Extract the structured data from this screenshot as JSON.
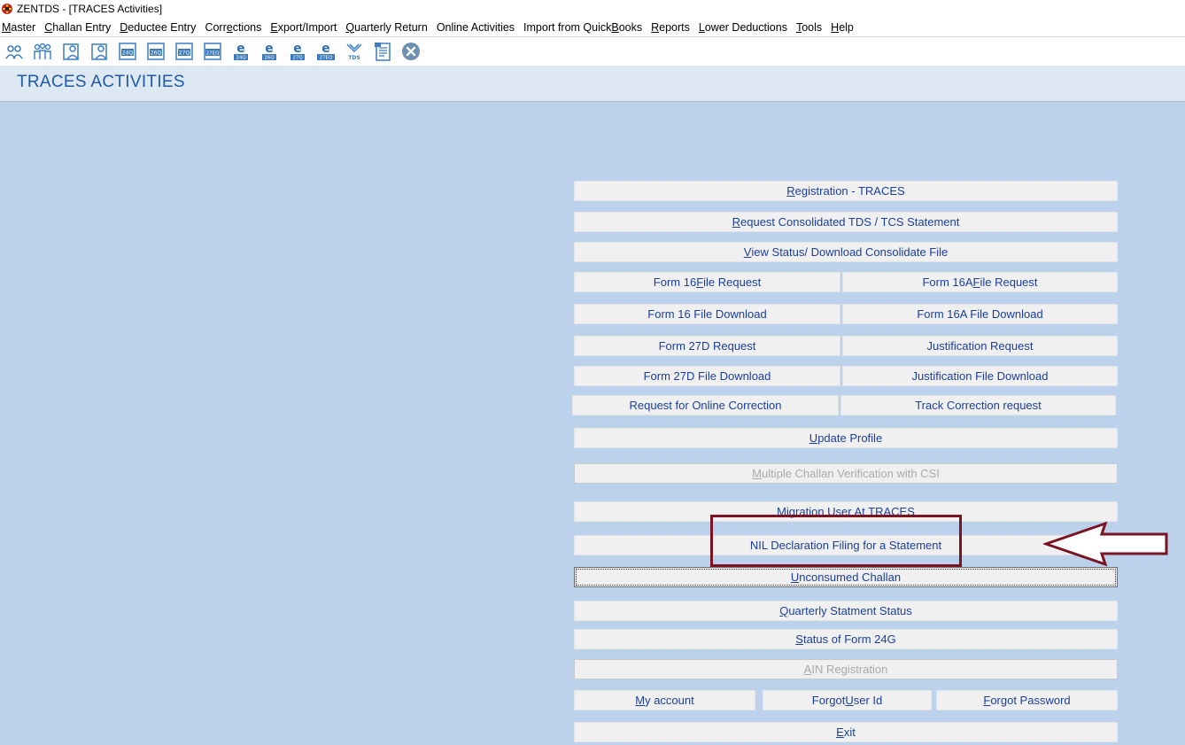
{
  "window": {
    "title": "ZENTDS - [TRACES Activities]"
  },
  "menu": [
    {
      "pre": "",
      "ul": "M",
      "post": "aster"
    },
    {
      "pre": "",
      "ul": "C",
      "post": "hallan Entry"
    },
    {
      "pre": "",
      "ul": "D",
      "post": "eductee Entry"
    },
    {
      "pre": "Corr",
      "ul": "e",
      "post": "ctions"
    },
    {
      "pre": "",
      "ul": "E",
      "post": "xport/Import"
    },
    {
      "pre": "",
      "ul": "Q",
      "post": "uarterly Return"
    },
    {
      "pre": "Online Activities",
      "ul": "",
      "post": ""
    },
    {
      "pre": "Import from Quick",
      "ul": "B",
      "post": "ooks"
    },
    {
      "pre": "",
      "ul": "R",
      "post": "eports"
    },
    {
      "pre": "",
      "ul": "L",
      "post": "ower Deductions"
    },
    {
      "pre": "",
      "ul": "T",
      "post": "ools"
    },
    {
      "pre": "",
      "ul": "H",
      "post": "elp"
    }
  ],
  "toolbar": {
    "tag_24q": "24Q",
    "tag_26q": "26Q",
    "tag_27q": "27Q",
    "tag_27eq": "27EQ",
    "tag_e24q": "24Q",
    "tag_e26q": "26Q",
    "tag_e27q": "27Q",
    "tag_e27eq": "27EQ",
    "tag_tds": "TDS",
    "tag_e": "e"
  },
  "page": {
    "heading": "TRACES ACTIVITIES"
  },
  "buttons": {
    "registration": {
      "pre": "",
      "ul": "R",
      "post": "egistration - TRACES"
    },
    "request_consolidated": {
      "pre": "",
      "ul": "R",
      "post": "equest Consolidated TDS / TCS Statement"
    },
    "view_status": {
      "pre": "",
      "ul": "V",
      "post": "iew Status/ Download Consolidate File"
    },
    "form16_request": {
      "pre": "Form 16 ",
      "ul": "F",
      "post": "ile Request"
    },
    "form16a_request": {
      "pre": "Form 16A ",
      "ul": "F",
      "post": "ile Request"
    },
    "form16_download": {
      "pre": "Form 16 File Download",
      "ul": "",
      "post": ""
    },
    "form16a_download": {
      "pre": "Form 16A File Download",
      "ul": "",
      "post": ""
    },
    "form27d_request": {
      "pre": "Form 27D Request",
      "ul": "",
      "post": ""
    },
    "justification_request": {
      "pre": "Justification Request",
      "ul": "",
      "post": ""
    },
    "form27d_download": {
      "pre": "Form 27D File Download",
      "ul": "",
      "post": ""
    },
    "justification_download": {
      "pre": "Justification File Download",
      "ul": "",
      "post": ""
    },
    "online_correction": {
      "pre": "Request for Online Correction",
      "ul": "",
      "post": ""
    },
    "track_correction": {
      "pre": "Track Correction request",
      "ul": "",
      "post": ""
    },
    "update_profile": {
      "pre": "",
      "ul": "U",
      "post": "pdate Profile"
    },
    "multiple_challan": {
      "pre": "",
      "ul": "M",
      "post": "ultiple Challan Verification with CSI"
    },
    "migration_user": {
      "pre": "Migration User At TRACES",
      "ul": "",
      "post": ""
    },
    "nil_declaration": {
      "pre": "NIL Declaration Filing for a Statement",
      "ul": "",
      "post": ""
    },
    "unconsumed_challan": {
      "pre": "",
      "ul": "U",
      "post": "nconsumed Challan"
    },
    "quarterly_status": {
      "pre": "",
      "ul": "Q",
      "post": "uarterly Statment Status"
    },
    "status_24g": {
      "pre": "",
      "ul": "S",
      "post": "tatus of Form 24G"
    },
    "ain_registration": {
      "pre": "",
      "ul": "A",
      "post": "IN Registration"
    },
    "my_account": {
      "pre": "",
      "ul": "M",
      "post": "y account"
    },
    "forgot_user": {
      "pre": "Forgot ",
      "ul": "U",
      "post": "ser Id"
    },
    "forgot_password": {
      "pre": "",
      "ul": "F",
      "post": "orgot Password"
    },
    "exit": {
      "pre": "",
      "ul": "E",
      "post": "xit"
    }
  },
  "colors": {
    "background": "#bcd2ec",
    "header_band": "#dde8f3",
    "heading_text": "#1f5aa6",
    "button_text": "#1a3f9a",
    "annotation": "#7a1322"
  }
}
